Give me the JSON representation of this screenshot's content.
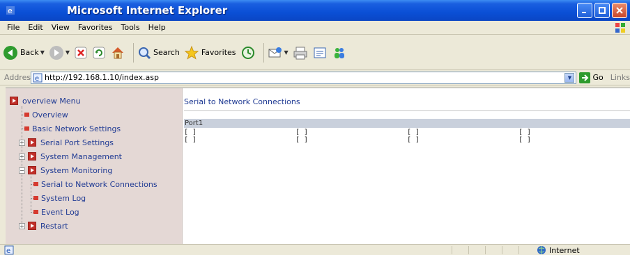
{
  "window": {
    "title": "Microsoft Internet Explorer"
  },
  "menu": [
    "File",
    "Edit",
    "View",
    "Favorites",
    "Tools",
    "Help"
  ],
  "toolbar": {
    "back_label": "Back",
    "search_label": "Search",
    "favorites_label": "Favorites"
  },
  "address": {
    "label": "Address",
    "url": "http://192.168.1.10/index.asp",
    "go_label": "Go",
    "links_label": "Links"
  },
  "sidebar": {
    "items": [
      {
        "label": "overview Menu"
      },
      {
        "label": "Overview"
      },
      {
        "label": "Basic Network Settings"
      },
      {
        "label": "Serial Port Settings"
      },
      {
        "label": "System Management"
      },
      {
        "label": "System Monitoring"
      },
      {
        "label": "Serial to Network Connections"
      },
      {
        "label": "System Log"
      },
      {
        "label": "Event Log"
      },
      {
        "label": "Restart"
      }
    ]
  },
  "main": {
    "title": "Serial to Network Connections",
    "port_label": "Port1",
    "rows": [
      [
        "[ ]",
        "[ ]",
        "[ ]",
        "[ ]"
      ],
      [
        "[ ]",
        "[ ]",
        "[ ]",
        "[ ]"
      ]
    ]
  },
  "status": {
    "zone": "Internet"
  }
}
